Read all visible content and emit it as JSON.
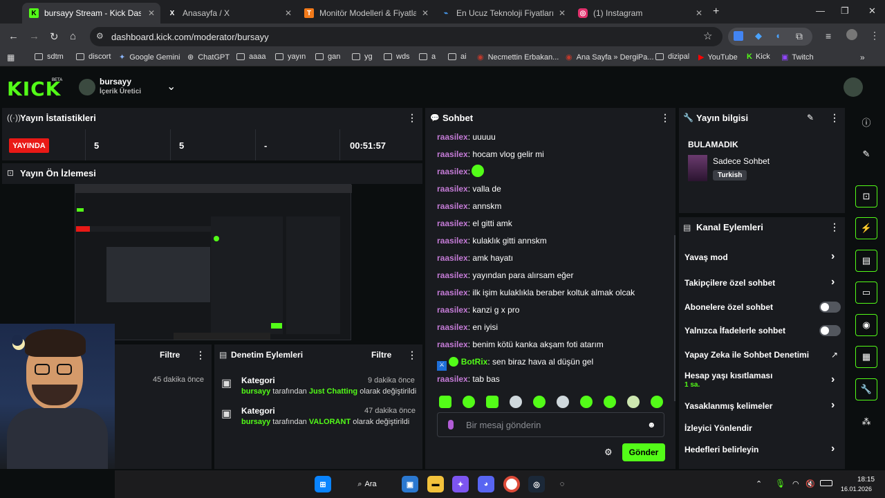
{
  "tabs": [
    {
      "title": "bursayy Stream - Kick Dashboard",
      "favicon": "K",
      "color": "#53fc18"
    },
    {
      "title": "Anasayfa / X",
      "favicon": "X",
      "color": "#000000"
    },
    {
      "title": "Monitör Modelleri & Fiyatları | Uygun",
      "favicon": "T",
      "color": "#f27a1a"
    },
    {
      "title": "En Ucuz Teknoloji Fiyatlarını ara",
      "favicon": "⌁",
      "color": "#1e6fd9"
    },
    {
      "title": "(1) Instagram",
      "favicon": "◎",
      "color": "#e1306c"
    }
  ],
  "url": "dashboard.kick.com/moderator/bursayy",
  "bookmarks": [
    "sdtm",
    "discort",
    "Google Gemini",
    "ChatGPT",
    "aaaa",
    "yayın",
    "gan",
    "yg",
    "wds",
    "a",
    "ai",
    "Necmettin Erbakan...",
    "Ana Sayfa » DergiPa...",
    "dizipal",
    "YouTube",
    "Kick",
    "Twitch"
  ],
  "header": {
    "logo": "KICK",
    "beta": "BETA",
    "channel": "bursayy",
    "role": "İçerik Üretici"
  },
  "stats": {
    "title": "Yayın İstatistikleri",
    "live": "YAYINDA",
    "viewers": "5",
    "followers": "5",
    "subs": "-",
    "uptime": "00:51:57"
  },
  "preview": {
    "title": "Yayın Ön İzlemesi"
  },
  "chat": {
    "title": "Sohbet",
    "messages": [
      {
        "user": "raasilex",
        "text": "uuuuu"
      },
      {
        "user": "raasilex",
        "text": "hocam vlog gelir mi"
      },
      {
        "user": "raasilex",
        "text": ""
      },
      {
        "user": "raasilex",
        "text": "valla de"
      },
      {
        "user": "raasilex",
        "text": "annskm"
      },
      {
        "user": "raasilex",
        "text": "el gitti amk"
      },
      {
        "user": "raasilex",
        "text": "kulaklık gitti annskm"
      },
      {
        "user": "raasilex",
        "text": "amk hayatı"
      },
      {
        "user": "raasilex",
        "text": "yayından para alırsam eğer"
      },
      {
        "user": "raasilex",
        "text": "ilk işim kulaklıkla beraber koltuk almak olcak"
      },
      {
        "user": "raasilex",
        "text": "kanzi g x pro"
      },
      {
        "user": "raasilex",
        "text": "en iyisi"
      },
      {
        "user": "raasilex",
        "text": "benim kötü kanka akşam foti atarım"
      },
      {
        "user": "BotRix",
        "text": "sen biraz hava al düşün gel"
      },
      {
        "user": "raasilex",
        "text": "tab bas"
      }
    ],
    "placeholder": "Bir mesaj gönderin",
    "send": "Gönder"
  },
  "info": {
    "title": "Yayın bilgisi",
    "stream_title": "BULAMADIK",
    "category": "Sadece Sohbet",
    "language": "Turkish"
  },
  "actions": {
    "title": "Kanal Eylemleri",
    "items": [
      {
        "label": "Yavaş mod",
        "type": "chevron"
      },
      {
        "label": "Takipçilere özel sohbet",
        "type": "chevron"
      },
      {
        "label": "Abonelere özel sohbet",
        "type": "toggle"
      },
      {
        "label": "Yalnızca İfadelerle sohbet",
        "type": "toggle"
      },
      {
        "label": "Yapay Zeka ile Sohbet Denetimi",
        "type": "external"
      },
      {
        "label": "Hesap yaşı kısıtlaması",
        "type": "chevron",
        "sub": "1 sa."
      },
      {
        "label": "Yasaklanmış kelimeler",
        "type": "chevron"
      },
      {
        "label": "İzleyici Yönlendir",
        "type": "none"
      },
      {
        "label": "Hedefleri belirleyin",
        "type": "chevron"
      }
    ]
  },
  "audit": {
    "title": "Denetim Eylemleri",
    "filter": "Filtre",
    "left_filter": "Filtre",
    "left_time": "45 dakika önce",
    "events": [
      {
        "title": "Kategori",
        "user": "bursayy",
        "mid": "tarafından",
        "value": "Just Chatting",
        "tail": "olarak değiştirildi",
        "time": "9 dakika önce"
      },
      {
        "title": "Kategori",
        "user": "bursayy",
        "mid": "tarafından",
        "value": "VALORANT",
        "tail": "olarak değiştirildi",
        "time": "47 dakika önce"
      }
    ]
  },
  "taskbar": {
    "search": "Ara",
    "time": "18:15",
    "date": "16.01.2026"
  }
}
